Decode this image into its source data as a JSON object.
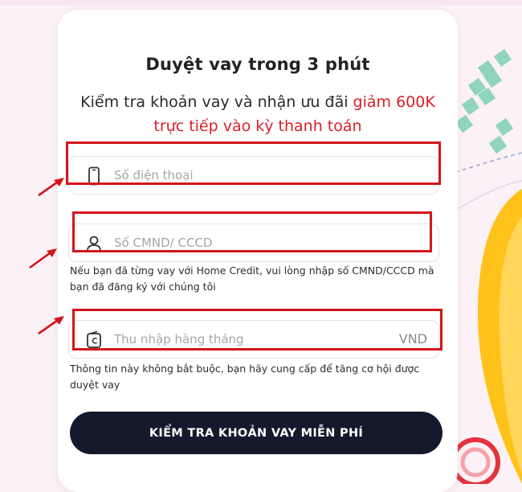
{
  "form": {
    "title": "Duyệt vay trong 3 phút",
    "subtitle_part1": "Kiểm tra khoản vay và nhận ưu đãi",
    "subtitle_highlight1": "giảm 600K",
    "subtitle_highlight2": "trực tiếp vào kỳ thanh toán",
    "phone": {
      "placeholder": "Số điện thoại",
      "icon": "phone-icon"
    },
    "id_card": {
      "placeholder": "Số CMND/ CCCD",
      "icon": "user-icon"
    },
    "id_hint": "Nếu bạn đã từng vay với Home Credit, vui lòng nhập số CMND/CCCD mà bạn đã đăng ký với chúng tôi",
    "income": {
      "placeholder": "Thu nhập hàng tháng",
      "suffix": "VND",
      "icon": "wallet-icon"
    },
    "income_hint": "Thông tin này không bắt buộc, bạn hãy cung cấp để tăng cơ hội được duyệt vay",
    "submit_label": "KIỂM TRA KHOẢN VAY MIỄN PHÍ"
  },
  "colors": {
    "accent_red": "#d8202a",
    "annotation_red": "#d4141c",
    "button_bg": "#141a2b"
  }
}
